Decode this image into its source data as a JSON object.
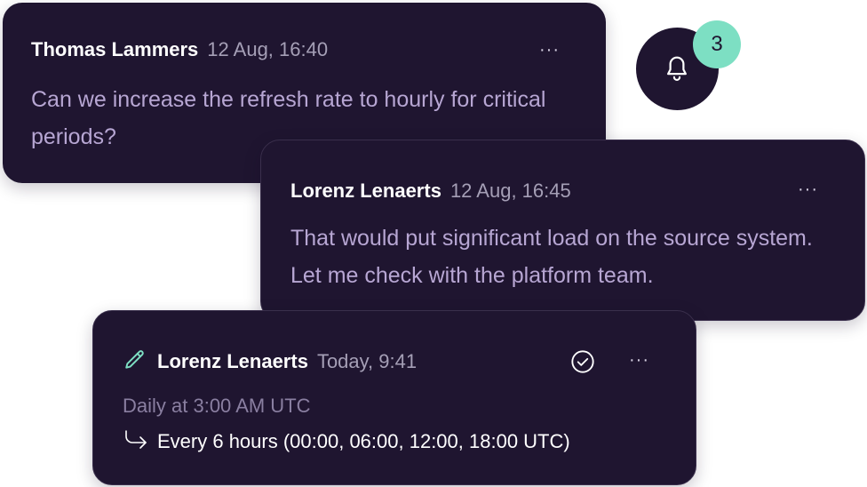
{
  "colors": {
    "card_bg": "#1f1530",
    "message_text": "#b7a6d3",
    "timestamp": "#a59fb6",
    "accent_teal": "#7ddfc3"
  },
  "notifications": {
    "icon": "bell-icon",
    "count": "3"
  },
  "comments": [
    {
      "author": "Thomas Lammers",
      "time": "12 Aug, 16:40",
      "more": "···",
      "message": "Can we increase the refresh rate to hourly for critical periods?"
    },
    {
      "author": "Lorenz Lenaerts",
      "time": "12 Aug, 16:45",
      "more": "···",
      "message": "That would put significant load on the source system. Let me check with the platform team."
    }
  ],
  "edit": {
    "icon": "pencil-icon",
    "author": "Lorenz Lenaerts",
    "time": "Today, 9:41",
    "resolve_icon": "check-circle-icon",
    "more": "···",
    "old_value": "Daily at 3:00 AM UTC",
    "new_value": "Every 6 hours (00:00, 06:00, 12:00, 18:00 UTC)"
  }
}
